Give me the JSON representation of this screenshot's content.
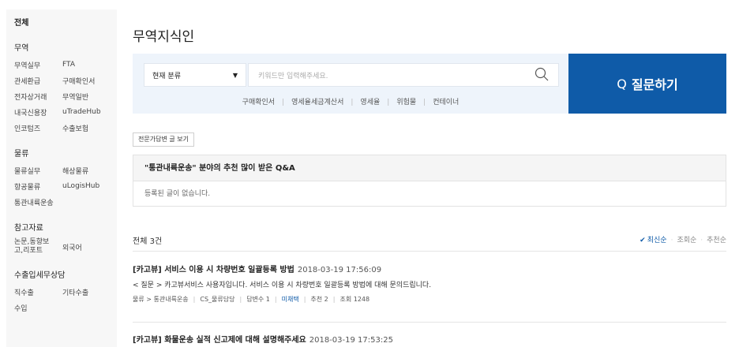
{
  "sidebar": {
    "all": "전체",
    "groups": [
      {
        "title": "무역",
        "rows": [
          [
            "무역실무",
            "FTA"
          ],
          [
            "관세환급",
            "구매확인서"
          ],
          [
            "전자상거래",
            "무역일반"
          ],
          [
            "내국신용장",
            "uTradeHub"
          ],
          [
            "인코텀즈",
            "수출보험"
          ]
        ]
      },
      {
        "title": "물류",
        "rows": [
          [
            "물류실무",
            "해상물류"
          ],
          [
            "항공물류",
            "uLogisHub"
          ],
          [
            "통관내륙운송",
            ""
          ]
        ]
      },
      {
        "title": "참고자료",
        "rows": [
          [
            "논문,동향보고,리포트",
            "외국어"
          ]
        ]
      },
      {
        "title": "수출입세무상담",
        "rows": [
          [
            "직수출",
            "기타수출"
          ],
          [
            "수입",
            ""
          ]
        ]
      }
    ]
  },
  "main": {
    "title": "무역지식인",
    "search": {
      "category": "현재 분류",
      "placeholder": "키워드만 입력해주세요.",
      "tags": [
        "구매확인서",
        "영세율세금계산서",
        "영세율",
        "위험물",
        "컨테이너"
      ]
    },
    "ask_button": {
      "q": "Q",
      "label": "질문하기"
    },
    "expert_button": "전문가답변 글 보기",
    "recommend": {
      "title": "\"통관내륙운송\" 분야의 추천 많이 받은 Q&A",
      "empty": "등록된 글이 없습니다."
    },
    "list": {
      "total": "전체 3건",
      "sorts": [
        "최신순",
        "조회순",
        "추천순"
      ],
      "posts": [
        {
          "title": "[카고뷰] 서비스 이용 시 차량번호 일괄등록 방법",
          "date": "2018-03-19 17:56:09",
          "question": "< 질문 >  카고뷰서비스 사용자입니다. 서비스 이용 시 차량번호 일괄등록 방법에 대해 문의드립니다.",
          "category": "물류 > 통관내륙운송",
          "author": "CS_물류담당",
          "answers": "답변수 1",
          "status": "미채택",
          "recommend": "추천 2",
          "views": "조회 1248"
        },
        {
          "title": "[카고뷰] 화물운송 실적 신고제에 대해 설명해주세요",
          "date": "2018-03-19 17:53:25"
        }
      ]
    }
  },
  "colors": {
    "accent": "#0f5ba8",
    "search_bg": "#eef4fb",
    "sidebar_bg": "#f7f7f7"
  },
  "icons": {
    "search": "magnifier-icon",
    "dropdown": "chevron-down-icon",
    "sort_active": "check-icon"
  }
}
